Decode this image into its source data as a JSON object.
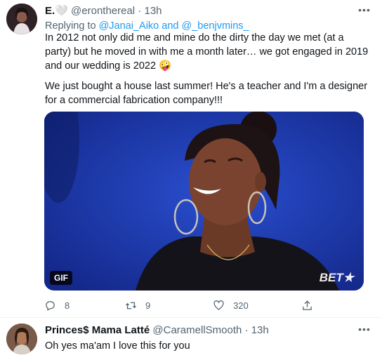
{
  "tweets": [
    {
      "name": "E.🤍",
      "handle": "@eronthereal",
      "dot": "·",
      "time": "13h",
      "more": "•••",
      "reply_prefix": "Replying to",
      "reply_user1": "@Janai_Aiko",
      "reply_and": "and",
      "reply_user2": "@_benjvmins_",
      "text_p1": "In 2012 not only did me and mine do the dirty the day we met (at a party) but he moved in with me a month later… we got engaged in 2019 and our wedding is 2022 🤪",
      "text_p2": "We just bought a house last summer! He's a teacher and I'm a designer for a commercial fabrication company!!!",
      "media": {
        "badge": "GIF",
        "watermark": "BET★"
      },
      "actions": {
        "replies": "8",
        "retweets": "9",
        "likes": "320"
      }
    },
    {
      "name": "Princes$ Mama Latté",
      "handle": "@CaramellSmooth",
      "dot": "·",
      "time": "13h",
      "more": "•••",
      "text": "Oh yes ma'am I love this for you"
    }
  ],
  "colors": {
    "accent": "#1d9bf0",
    "secondary_text": "#536471",
    "primary_text": "#0f1419",
    "media_background": "#1d39a8"
  },
  "icons": [
    "reply-icon",
    "retweet-icon",
    "like-icon",
    "share-icon",
    "more-icon"
  ]
}
